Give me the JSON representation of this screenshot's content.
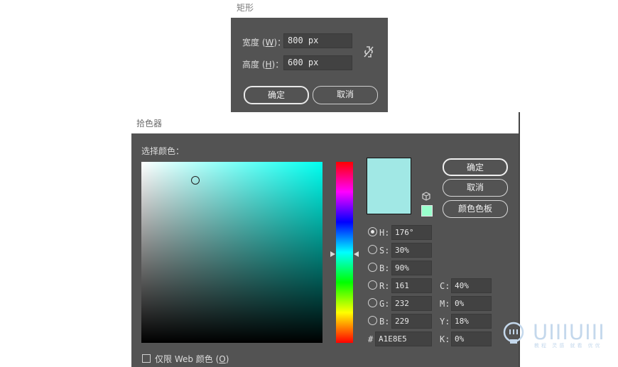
{
  "rectangle_dialog": {
    "title": "矩形",
    "width_label": "宽度",
    "width_key": "W",
    "width_value": "800 px",
    "height_label": "高度",
    "height_key": "H",
    "height_value": "600 px",
    "ok_label": "确定",
    "cancel_label": "取消"
  },
  "color_picker": {
    "title": "拾色器",
    "select_color_label": "选择颜色：",
    "ok_label": "确定",
    "cancel_label": "取消",
    "swatches_label": "颜色色板",
    "current_color": "#A1E8E5",
    "websafe_color": "#99FFCC",
    "hue_color": "#00FFF0",
    "fields": {
      "h_label": "H:",
      "h_value": "176°",
      "s_label": "S:",
      "s_value": "30%",
      "b_label": "B:",
      "b_value": "90%",
      "r_label": "R:",
      "r_value": "161",
      "g_label": "G:",
      "g_value": "232",
      "blue_label": "B:",
      "blue_value": "229",
      "hex_label": "#",
      "hex_value": "A1E8E5",
      "c_label": "C:",
      "c_value": "40%",
      "m_label": "M:",
      "m_value": "0%",
      "y_label": "Y:",
      "y_value": "18%",
      "k_label": "K:",
      "k_value": "0%"
    },
    "web_only_label": "仅限 Web 颜色",
    "web_only_key": "O"
  },
  "watermark": {
    "text": "UIIIUIII",
    "sub": "教程 灵感 就看 优优"
  }
}
